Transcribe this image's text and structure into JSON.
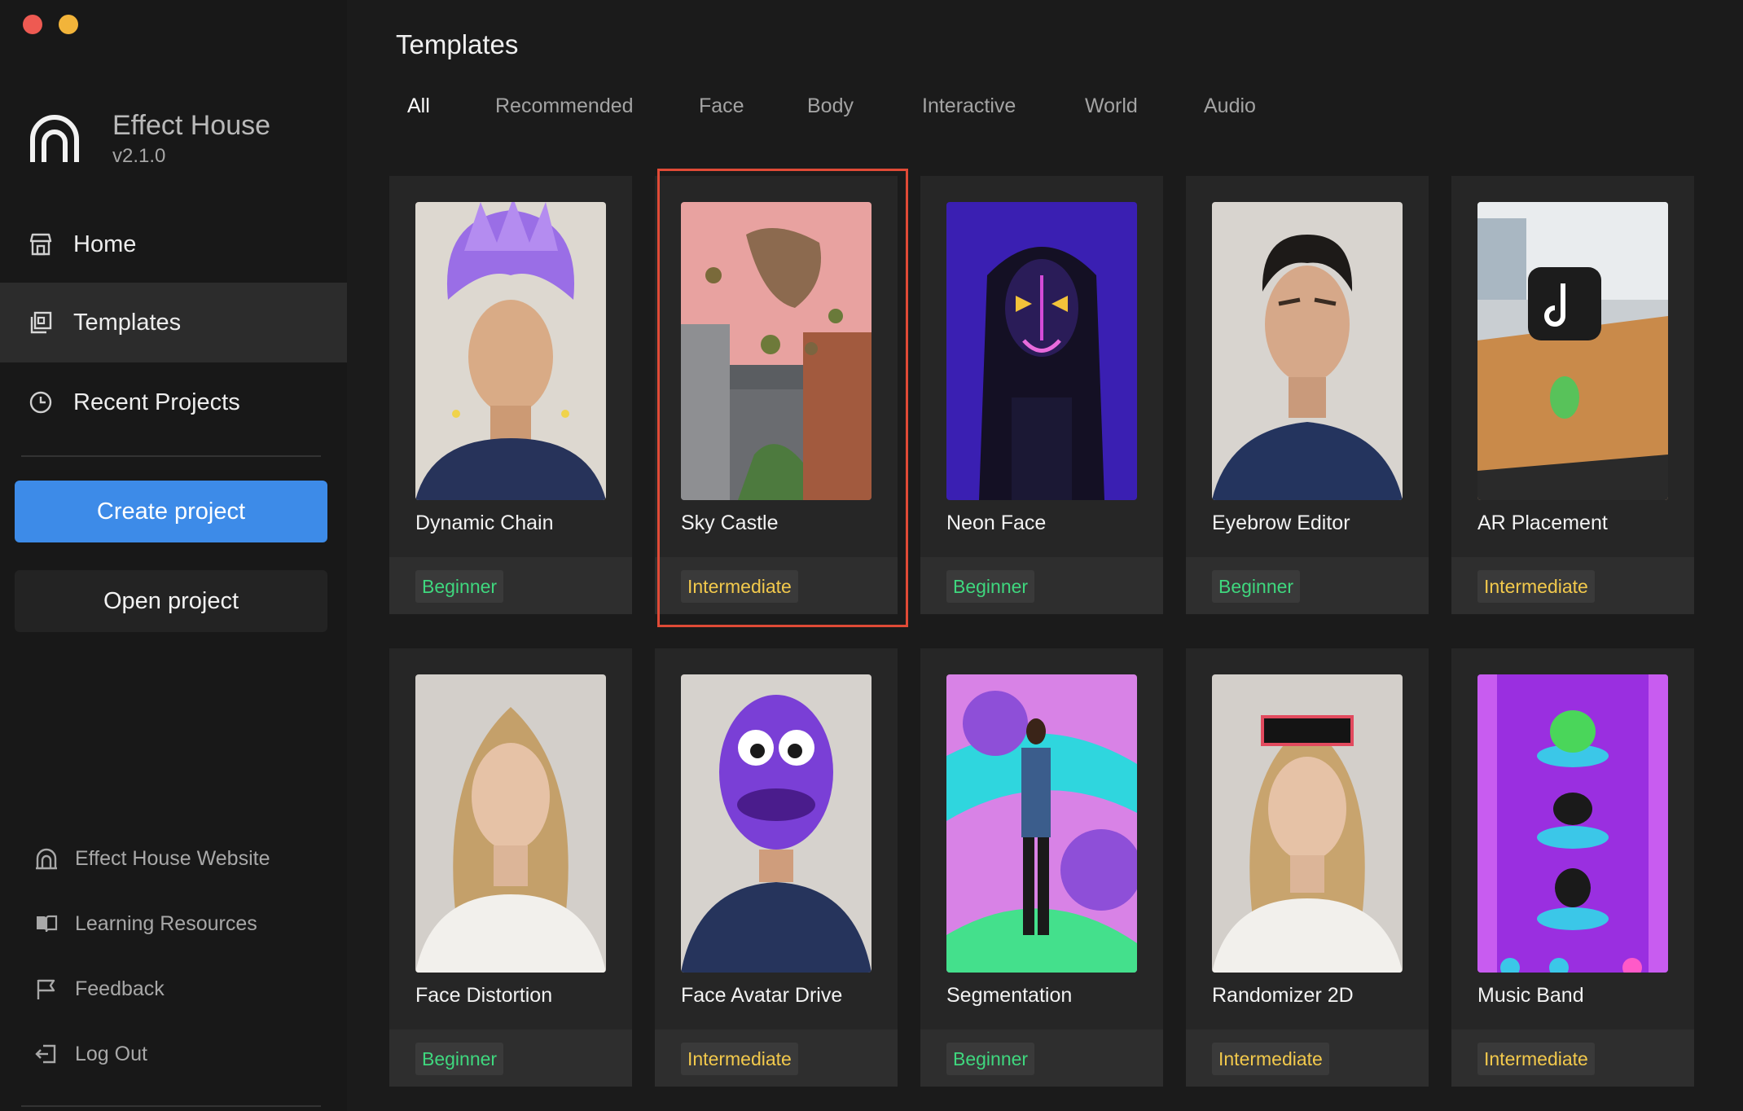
{
  "app": {
    "name": "Effect House",
    "version": "v2.1.0"
  },
  "sidebar": {
    "nav": [
      {
        "label": "Home",
        "icon": "home-icon"
      },
      {
        "label": "Templates",
        "icon": "templates-icon",
        "active": true
      },
      {
        "label": "Recent Projects",
        "icon": "clock-icon"
      }
    ],
    "create_label": "Create project",
    "open_label": "Open project",
    "footer": [
      {
        "label": "Effect House Website",
        "icon": "website-icon"
      },
      {
        "label": "Learning Resources",
        "icon": "book-icon"
      },
      {
        "label": "Feedback",
        "icon": "flag-icon"
      },
      {
        "label": "Log Out",
        "icon": "logout-icon"
      }
    ]
  },
  "main": {
    "title": "Templates",
    "tabs": [
      {
        "label": "All",
        "active": true
      },
      {
        "label": "Recommended"
      },
      {
        "label": "Face"
      },
      {
        "label": "Body"
      },
      {
        "label": "Interactive"
      },
      {
        "label": "World"
      },
      {
        "label": "Audio"
      }
    ],
    "cards": [
      {
        "title": "Dynamic Chain",
        "level": "Beginner"
      },
      {
        "title": "Sky Castle",
        "level": "Intermediate",
        "selected": true
      },
      {
        "title": "Neon Face",
        "level": "Beginner"
      },
      {
        "title": "Eyebrow Editor",
        "level": "Beginner"
      },
      {
        "title": "AR Placement",
        "level": "Intermediate"
      },
      {
        "title": "Face Distortion",
        "level": "Beginner"
      },
      {
        "title": "Face Avatar Drive",
        "level": "Intermediate"
      },
      {
        "title": "Segmentation",
        "level": "Beginner"
      },
      {
        "title": "Randomizer 2D",
        "level": "Intermediate"
      },
      {
        "title": "Music Band",
        "level": "Intermediate"
      }
    ]
  },
  "colors": {
    "accent": "#3d8be8",
    "beginner": "#3fd77e",
    "intermediate": "#f2c94c",
    "selection": "#e04a36"
  }
}
